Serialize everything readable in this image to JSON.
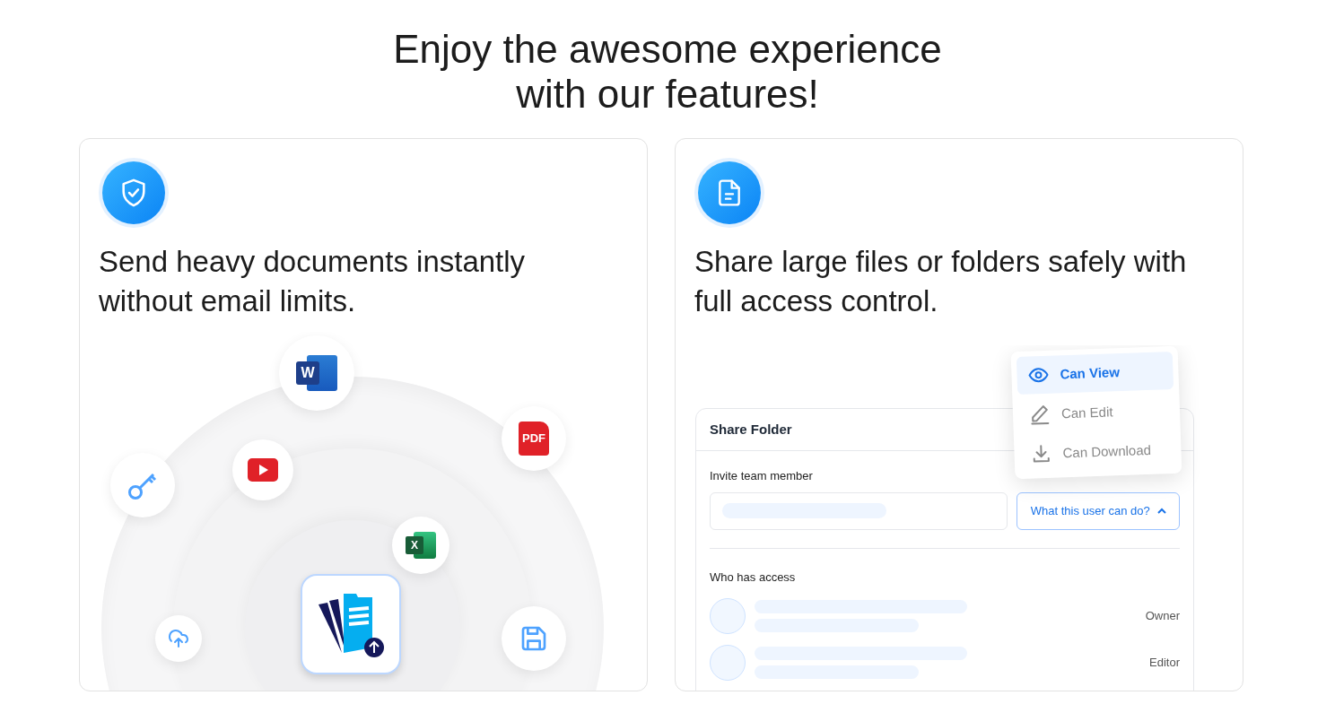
{
  "heading": [
    "Enjoy the awesome experience",
    "with our features!"
  ],
  "features": [
    {
      "kind": "send",
      "title": [
        "Send heavy documents instantly",
        "without email limits."
      ],
      "badges": [
        {
          "kind": "word",
          "label": "W"
        },
        {
          "kind": "pdf",
          "label": "PDF"
        },
        {
          "kind": "key"
        },
        {
          "kind": "youtube"
        },
        {
          "kind": "excel",
          "label": "X"
        },
        {
          "kind": "upload"
        },
        {
          "kind": "save"
        }
      ]
    },
    {
      "kind": "share",
      "title": [
        "Share large files or folders safely with",
        "full access control."
      ],
      "share_panel": {
        "title": "Share Folder",
        "invite_label": "Invite team member",
        "permission_button": "What this user can do?",
        "menu_expanded": true,
        "access_label": "Who has access",
        "members": [
          {
            "role": "Owner"
          },
          {
            "role": "Editor"
          }
        ],
        "menu": [
          {
            "kind": "view",
            "label": "Can View",
            "selected": true
          },
          {
            "kind": "edit",
            "label": "Can Edit",
            "selected": false
          },
          {
            "kind": "download",
            "label": "Can Download",
            "selected": false
          }
        ]
      }
    }
  ]
}
